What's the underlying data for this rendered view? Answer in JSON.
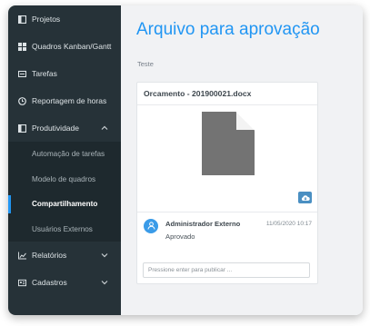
{
  "sidebar": {
    "items": [
      {
        "label": "Projetos",
        "icon": "book-icon"
      },
      {
        "label": "Quadros Kanban/Gantt",
        "icon": "grid-icon"
      },
      {
        "label": "Tarefas",
        "icon": "card-icon"
      },
      {
        "label": "Reportagem de horas",
        "icon": "clock-icon"
      },
      {
        "label": "Produtividade",
        "icon": "book-icon",
        "expanded": true
      }
    ],
    "sub_items": [
      {
        "label": "Automação de tarefas"
      },
      {
        "label": "Modelo de quadros"
      },
      {
        "label": "Compartilhamento",
        "active": true
      },
      {
        "label": "Usuários Externos"
      }
    ],
    "bottom_items": [
      {
        "label": "Relatórios",
        "icon": "chart-icon"
      },
      {
        "label": "Cadastros",
        "icon": "id-card-icon"
      }
    ]
  },
  "page": {
    "title": "Arquivo para aprovação",
    "subtitle": "Teste"
  },
  "file_card": {
    "filename": "Orcamento - 201900021.docx",
    "comment": {
      "author": "Administrador Externo",
      "date": "11/05/2020 10:17",
      "status": "Aprovado"
    },
    "input_placeholder": "Pressione enter para publicar ..."
  },
  "colors": {
    "accent": "#2196f3",
    "sidebar_bg": "#263238",
    "file_icon": "#737373",
    "download_button": "#4a8fc2"
  }
}
